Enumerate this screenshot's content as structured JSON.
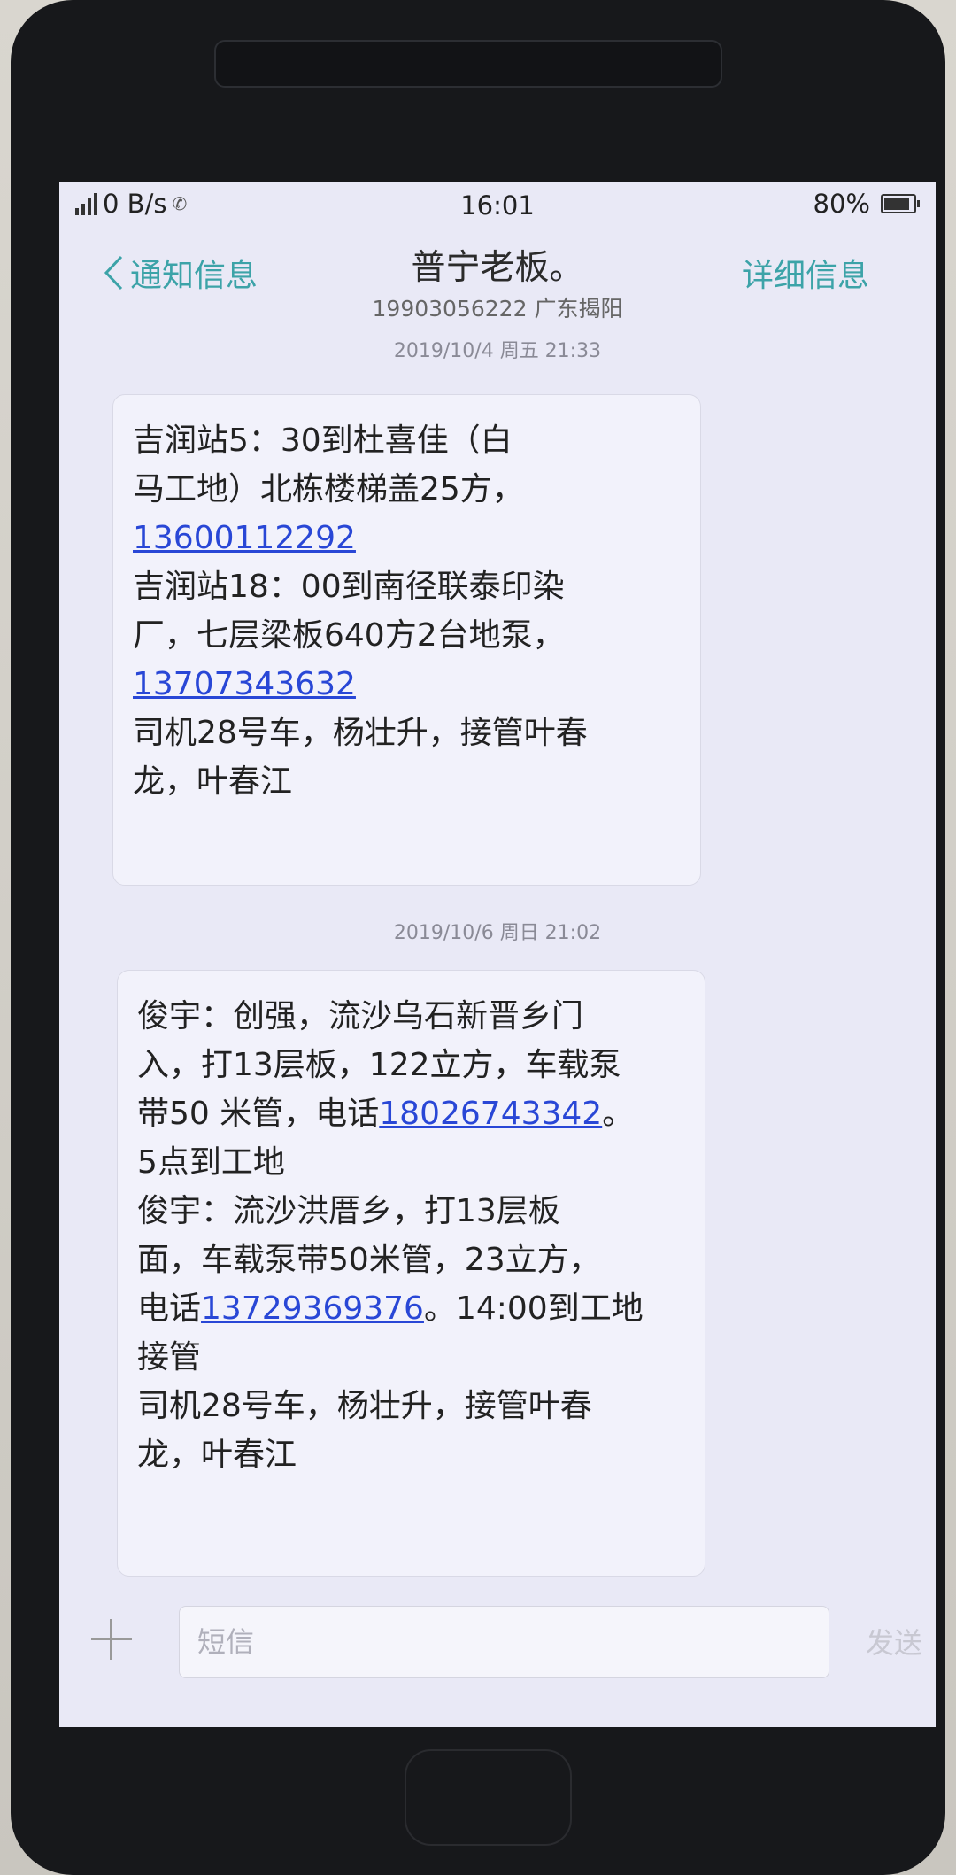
{
  "status_bar": {
    "net_speed": "0 B/s",
    "time": "16:01",
    "battery": "80%"
  },
  "nav": {
    "back_label": "通知信息",
    "contact_name": "普宁老板。",
    "contact_number_location": "19903056222 广东揭阳",
    "detail_label": "详细信息"
  },
  "messages": [
    {
      "timestamp": "2019/10/4 周五 21:33",
      "lines": [
        [
          "吉润站5：30到杜喜佳（白",
          ""
        ],
        [
          "马工地）北栋楼梯盖25方，",
          ""
        ],
        [
          "",
          "13600112292"
        ],
        [
          "吉润站18：00到南径联泰印染",
          ""
        ],
        [
          "厂，七层梁板640方2台地泵，",
          ""
        ],
        [
          "",
          "13707343632"
        ],
        [
          "司机28号车，杨壮升，接管叶春",
          ""
        ],
        [
          "龙，叶春江",
          ""
        ]
      ]
    },
    {
      "timestamp": "2019/10/6 周日 21:02",
      "lines": [
        [
          "俊宇：创强，流沙乌石新晋乡门",
          ""
        ],
        [
          "入，打13层板，122立方，车载泵",
          ""
        ],
        [
          "带50 米管，电话",
          "18026743342",
          "。"
        ],
        [
          "5点到工地",
          ""
        ],
        [
          "俊宇：流沙洪厝乡，打13层板",
          ""
        ],
        [
          "面，车载泵带50米管，23立方，",
          ""
        ],
        [
          "电话",
          "13729369376",
          "。14:00到工地"
        ],
        [
          "接管",
          ""
        ],
        [
          "司机28号车，杨壮升，接管叶春",
          ""
        ],
        [
          "龙，叶春江",
          ""
        ]
      ]
    }
  ],
  "composer": {
    "placeholder": "短信",
    "send_label": "发送"
  },
  "colors": {
    "accent": "#3ca3a8",
    "link": "#2947d6",
    "screen_bg": "#e9e9f6"
  }
}
